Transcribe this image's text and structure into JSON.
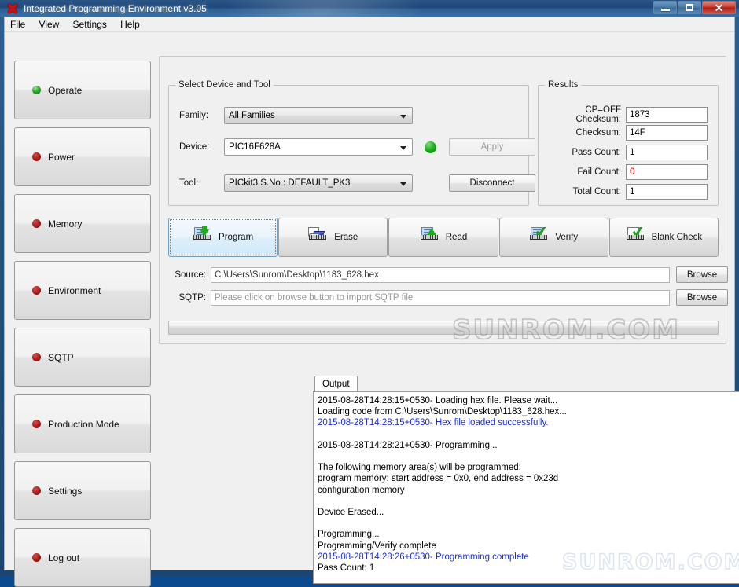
{
  "window": {
    "title": "Integrated Programming Environment v3.05",
    "app_icon": "ipe-icon",
    "controls": {
      "minimize": "minimize-button",
      "maximize": "maximize-button",
      "close": "close-button"
    }
  },
  "menubar": {
    "items": [
      "File",
      "View",
      "Settings",
      "Help"
    ]
  },
  "sidebar": {
    "items": [
      {
        "label": "Operate",
        "led": "green",
        "active": true
      },
      {
        "label": "Power",
        "led": "red",
        "active": false
      },
      {
        "label": "Memory",
        "led": "red",
        "active": false
      },
      {
        "label": "Environment",
        "led": "red",
        "active": false
      },
      {
        "label": "SQTP",
        "led": "red",
        "active": false
      },
      {
        "label": "Production Mode",
        "led": "red",
        "active": false
      },
      {
        "label": "Settings",
        "led": "red",
        "active": false
      },
      {
        "label": "Log out",
        "led": "red",
        "active": false
      }
    ]
  },
  "device_group": {
    "legend": "Select Device and Tool",
    "family_label": "Family:",
    "family_value": "All Families",
    "device_label": "Device:",
    "device_value": "PIC16F628A",
    "tool_label": "Tool:",
    "tool_value": "PICkit3 S.No : DEFAULT_PK3",
    "status_led": "green",
    "apply_label": "Apply",
    "disconnect_label": "Disconnect"
  },
  "results_group": {
    "legend": "Results",
    "rows": [
      {
        "label": "CP=OFF Checksum:",
        "value": "1873",
        "state": "normal"
      },
      {
        "label": "Checksum:",
        "value": "14F",
        "state": "normal"
      },
      {
        "label": "Pass Count:",
        "value": "1",
        "state": "normal"
      },
      {
        "label": "Fail Count:",
        "value": "0",
        "state": "fail"
      },
      {
        "label": "Total Count:",
        "value": "1",
        "state": "normal"
      }
    ]
  },
  "actions": [
    {
      "label": "Program",
      "icon": "program-icon",
      "selected": true
    },
    {
      "label": "Erase",
      "icon": "erase-icon",
      "selected": false
    },
    {
      "label": "Read",
      "icon": "read-icon",
      "selected": false
    },
    {
      "label": "Verify",
      "icon": "verify-icon",
      "selected": false
    },
    {
      "label": "Blank Check",
      "icon": "blank-check-icon",
      "selected": false
    }
  ],
  "source": {
    "label": "Source:",
    "value": "C:\\Users\\Sunrom\\Desktop\\1183_628.hex",
    "browse_label": "Browse"
  },
  "sqtp": {
    "label": "SQTP:",
    "placeholder": "Please click on browse button to import SQTP file",
    "browse_label": "Browse"
  },
  "progress": {
    "percent": 0
  },
  "output": {
    "tab_label": "Output",
    "lines": [
      {
        "text": "2015-08-28T14:28:15+0530- Loading hex file. Please wait...",
        "color": "black"
      },
      {
        "text": "Loading code from C:\\Users\\Sunrom\\Desktop\\1183_628.hex...",
        "color": "black"
      },
      {
        "text": "2015-08-28T14:28:15+0530- Hex file loaded successfully.",
        "color": "blue"
      },
      {
        "text": "",
        "color": "black"
      },
      {
        "text": "2015-08-28T14:28:21+0530- Programming...",
        "color": "black"
      },
      {
        "text": "",
        "color": "black"
      },
      {
        "text": "The following memory area(s) will be programmed:",
        "color": "black"
      },
      {
        "text": "program memory: start address = 0x0, end address = 0x23d",
        "color": "black"
      },
      {
        "text": "configuration memory",
        "color": "black"
      },
      {
        "text": "",
        "color": "black"
      },
      {
        "text": "Device Erased...",
        "color": "black"
      },
      {
        "text": "",
        "color": "black"
      },
      {
        "text": "Programming...",
        "color": "black"
      },
      {
        "text": "Programming/Verify complete",
        "color": "black"
      },
      {
        "text": "2015-08-28T14:28:26+0530- Programming complete",
        "color": "blue"
      },
      {
        "text": "Pass Count: 1",
        "color": "black"
      }
    ]
  },
  "watermark": {
    "text": "SUNROM.COM"
  },
  "colors": {
    "titlebar": "#24527f",
    "accent_blue": "#1a2ee0",
    "fail_red": "#d00000",
    "led_green": "#2cb42c",
    "led_red": "#a81818"
  }
}
